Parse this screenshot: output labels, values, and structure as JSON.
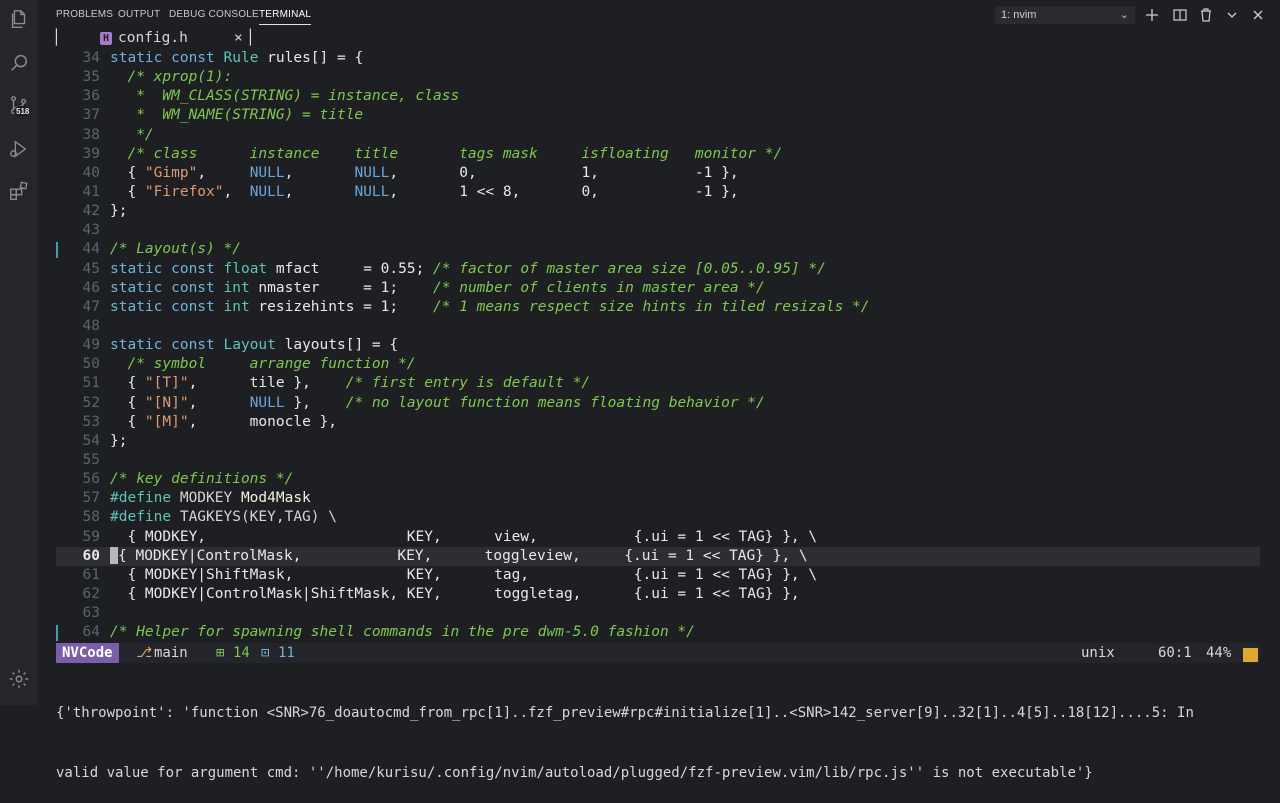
{
  "panel": {
    "tabs": [
      "PROBLEMS",
      "OUTPUT",
      "DEBUG CONSOLE",
      "TERMINAL"
    ],
    "active_tab": "TERMINAL",
    "terminal_select": "1: nvim"
  },
  "activity": {
    "scm_badge": "518"
  },
  "tabline": {
    "filename": "config.h",
    "close": "×",
    "icon_letter": "H"
  },
  "editor": {
    "lines": [
      {
        "n": "34",
        "tokens": [
          [
            "k",
            "static const "
          ],
          [
            "t",
            "Rule "
          ],
          [
            "n",
            "rules[] = {"
          ]
        ]
      },
      {
        "n": "35",
        "tokens": [
          [
            "c",
            "  /* xprop(1):"
          ]
        ]
      },
      {
        "n": "36",
        "tokens": [
          [
            "c",
            "   *  WM_CLASS(STRING) = instance, class"
          ]
        ]
      },
      {
        "n": "37",
        "tokens": [
          [
            "c",
            "   *  WM_NAME(STRING) = title"
          ]
        ]
      },
      {
        "n": "38",
        "tokens": [
          [
            "c",
            "   */"
          ]
        ]
      },
      {
        "n": "39",
        "tokens": [
          [
            "c",
            "  /* class      instance    title       tags mask     isfloating   monitor */"
          ]
        ]
      },
      {
        "n": "40",
        "tokens": [
          [
            "n",
            "  { "
          ],
          [
            "s",
            "\"Gimp\""
          ],
          [
            "n",
            ",     "
          ],
          [
            "nul",
            "NULL"
          ],
          [
            "n",
            ",       "
          ],
          [
            "nul",
            "NULL"
          ],
          [
            "n",
            ",       0,            1,           -1 },"
          ]
        ]
      },
      {
        "n": "41",
        "tokens": [
          [
            "n",
            "  { "
          ],
          [
            "s",
            "\"Firefox\""
          ],
          [
            "n",
            ",  "
          ],
          [
            "nul",
            "NULL"
          ],
          [
            "n",
            ",       "
          ],
          [
            "nul",
            "NULL"
          ],
          [
            "n",
            ",       1 << 8,       0,           -1 },"
          ]
        ]
      },
      {
        "n": "42",
        "tokens": [
          [
            "n",
            "};"
          ]
        ]
      },
      {
        "n": "43",
        "tokens": []
      },
      {
        "n": "44",
        "git": true,
        "tokens": [
          [
            "c",
            "/* Layout(s) */"
          ]
        ]
      },
      {
        "n": "45",
        "tokens": [
          [
            "k",
            "static const "
          ],
          [
            "t",
            "float "
          ],
          [
            "n",
            "mfact     = 0.55; "
          ],
          [
            "c",
            "/* factor of master area size [0.05..0.95] */"
          ]
        ]
      },
      {
        "n": "46",
        "tokens": [
          [
            "k",
            "static const "
          ],
          [
            "t",
            "int "
          ],
          [
            "n",
            "nmaster     = 1;    "
          ],
          [
            "c",
            "/* number of clients in master area */"
          ]
        ]
      },
      {
        "n": "47",
        "tokens": [
          [
            "k",
            "static const "
          ],
          [
            "t",
            "int "
          ],
          [
            "n",
            "resizehints = 1;    "
          ],
          [
            "c",
            "/* 1 means respect size hints in tiled resizals */"
          ]
        ]
      },
      {
        "n": "48",
        "tokens": []
      },
      {
        "n": "49",
        "tokens": [
          [
            "k",
            "static const "
          ],
          [
            "t",
            "Layout "
          ],
          [
            "n",
            "layouts[] = {"
          ]
        ]
      },
      {
        "n": "50",
        "tokens": [
          [
            "c",
            "  /* symbol     arrange function */"
          ]
        ]
      },
      {
        "n": "51",
        "tokens": [
          [
            "n",
            "  { "
          ],
          [
            "s",
            "\"[T]\""
          ],
          [
            "n",
            ",      tile },    "
          ],
          [
            "c",
            "/* first entry is default */"
          ]
        ]
      },
      {
        "n": "52",
        "tokens": [
          [
            "n",
            "  { "
          ],
          [
            "s",
            "\"[N]\""
          ],
          [
            "n",
            ",      "
          ],
          [
            "nul",
            "NULL"
          ],
          [
            "n",
            " },    "
          ],
          [
            "c",
            "/* no layout function means floating behavior */"
          ]
        ]
      },
      {
        "n": "53",
        "tokens": [
          [
            "n",
            "  { "
          ],
          [
            "s",
            "\"[M]\""
          ],
          [
            "n",
            ",      monocle },"
          ]
        ]
      },
      {
        "n": "54",
        "tokens": [
          [
            "n",
            "};"
          ]
        ]
      },
      {
        "n": "55",
        "tokens": []
      },
      {
        "n": "56",
        "tokens": [
          [
            "c",
            "/* key definitions */"
          ]
        ]
      },
      {
        "n": "57",
        "tokens": [
          [
            "t",
            "#define "
          ],
          [
            "pp",
            "MODKEY "
          ],
          [
            "fn",
            "Mod4Mask"
          ]
        ]
      },
      {
        "n": "58",
        "tokens": [
          [
            "t",
            "#define "
          ],
          [
            "pp",
            "TAGKEYS(KEY,TAG) \\"
          ]
        ]
      },
      {
        "n": "59",
        "tokens": [
          [
            "n",
            "  { MODKEY,                       KEY,      view,           {.ui = 1 << TAG} }, \\"
          ]
        ]
      },
      {
        "n": "60",
        "cur": true,
        "tokens": [
          [
            "n",
            "{ MODKEY|ControlMask,           KEY,      toggleview,     {.ui = 1 << TAG} }, \\"
          ]
        ]
      },
      {
        "n": "61",
        "tokens": [
          [
            "n",
            "  { MODKEY|ShiftMask,             KEY,      tag,            {.ui = 1 << TAG} }, \\"
          ]
        ]
      },
      {
        "n": "62",
        "tokens": [
          [
            "n",
            "  { MODKEY|ControlMask|ShiftMask, KEY,      toggletag,      {.ui = 1 << TAG} },"
          ]
        ]
      },
      {
        "n": "63",
        "tokens": []
      },
      {
        "n": "64",
        "git": true,
        "tokens": [
          [
            "c",
            "/* Helper for spawning shell commands in the pre dwm-5.0 fashion */"
          ]
        ]
      }
    ]
  },
  "statusline": {
    "mode": "NVCode",
    "branch_icon": "branch-icon",
    "branch": "main",
    "added": "14",
    "modified": "11",
    "fileformat": "unix",
    "position": "60:1",
    "percent": "44%"
  },
  "message": {
    "line1": "{'throwpoint': 'function <SNR>76_doautocmd_from_rpc[1]..fzf_preview#rpc#initialize[1]..<SNR>142_server[9]..32[1]..4[5]..18[12]....5: In",
    "line2": "valid value for argument cmd: ''/home/kurisu/.config/nvim/autoload/plugged/fzf-preview.vim/lib/rpc.js'' is not executable'}"
  },
  "colors": {
    "mode_bg": "#7a5ea8",
    "comment": "#7ec850",
    "keyword": "#6fb3d8",
    "type": "#5ec4b6",
    "string": "#e09a72"
  }
}
